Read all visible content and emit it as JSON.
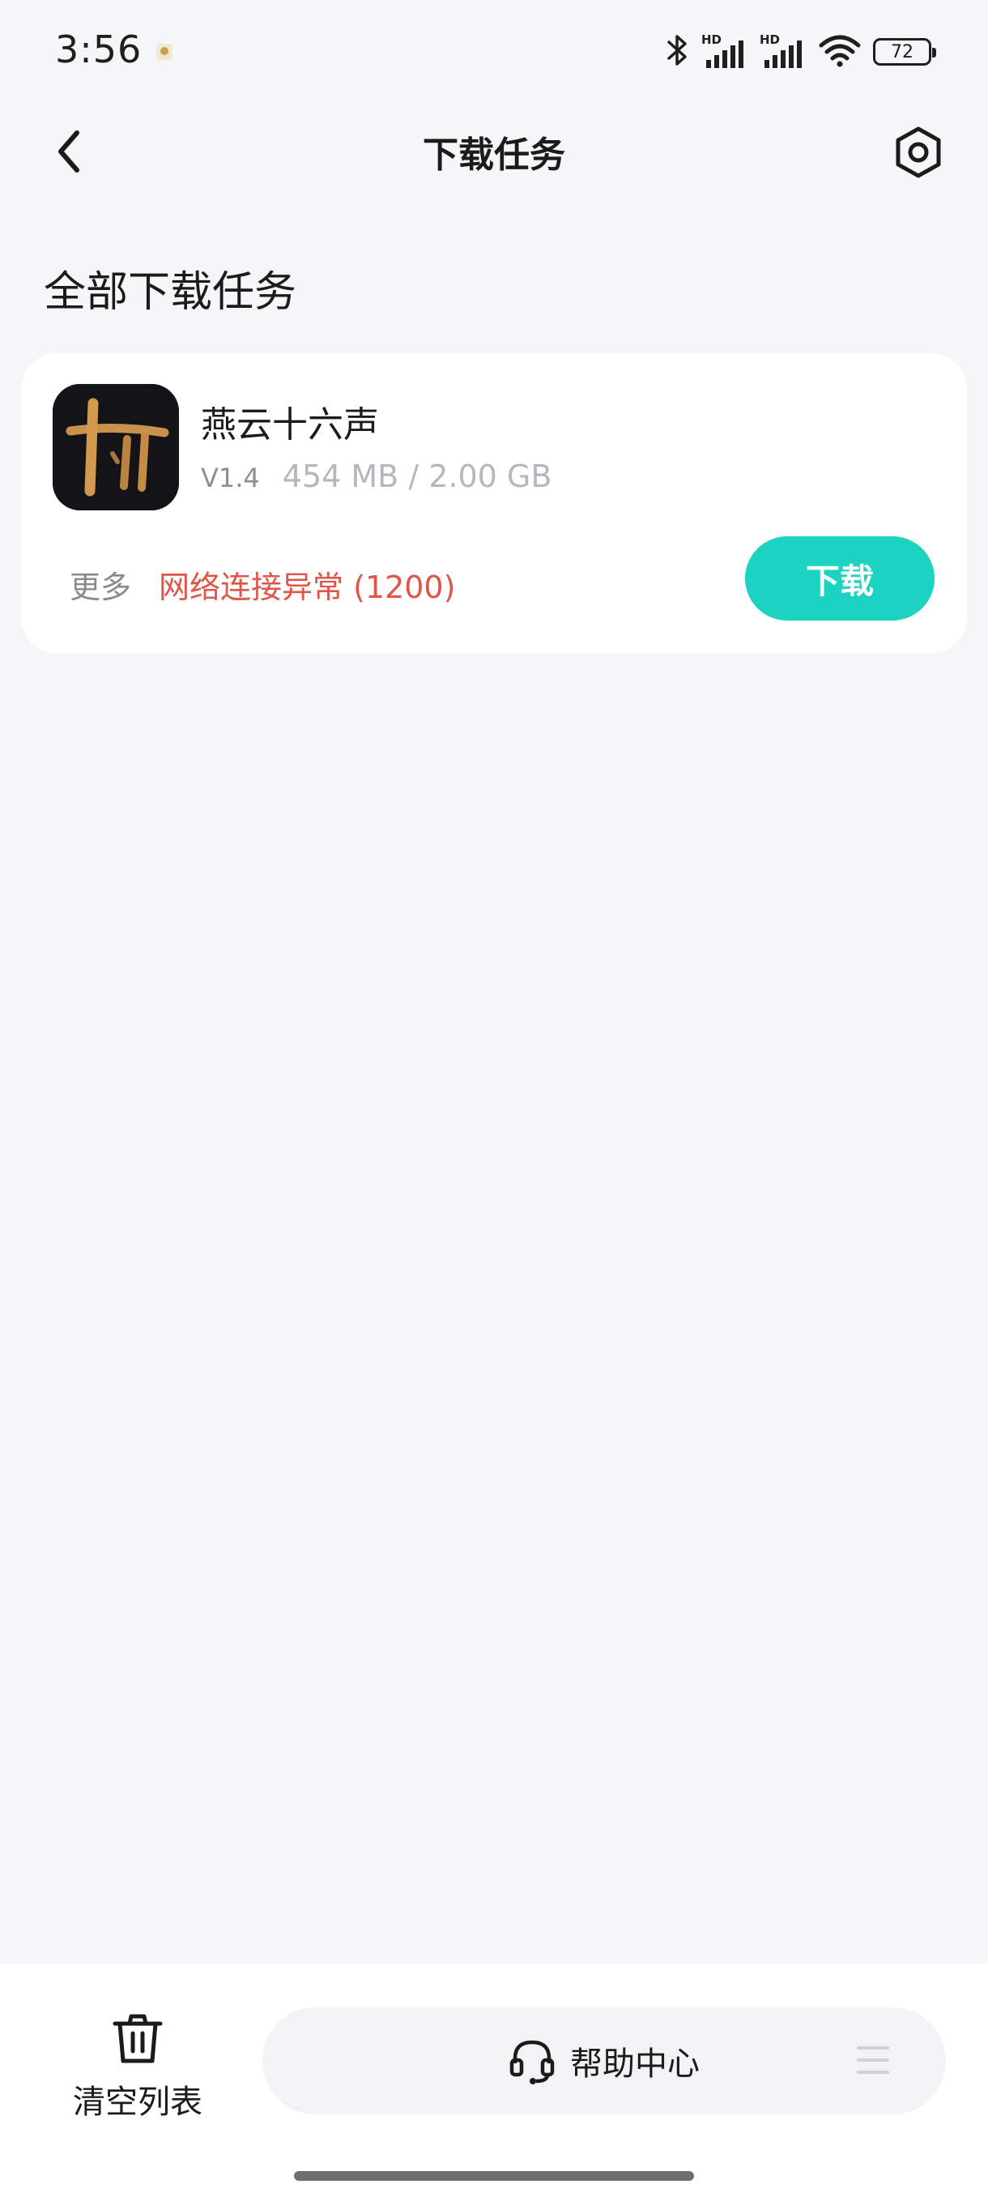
{
  "status_bar": {
    "time": "3:56",
    "signal_1_label": "HD",
    "signal_2_label": "HD",
    "battery_level": "72"
  },
  "header": {
    "title": "下载任务",
    "back_icon": "chevron-left-icon",
    "settings_icon": "hexagon-settings-icon"
  },
  "section": {
    "title": "全部下载任务"
  },
  "task": {
    "name": "燕云十六声",
    "version": "V1.4",
    "size": "454 MB / 2.00 GB",
    "more_label": "更多",
    "error": "网络连接异常 (1200)",
    "action_label": "下载",
    "accent_color": "#1cd2c0",
    "error_color": "#e0554a"
  },
  "bottom_bar": {
    "clear_label": "清空列表",
    "clear_icon": "trash-icon",
    "help_label": "帮助中心",
    "help_icon": "headset-icon",
    "menu_icon": "menu-icon"
  }
}
